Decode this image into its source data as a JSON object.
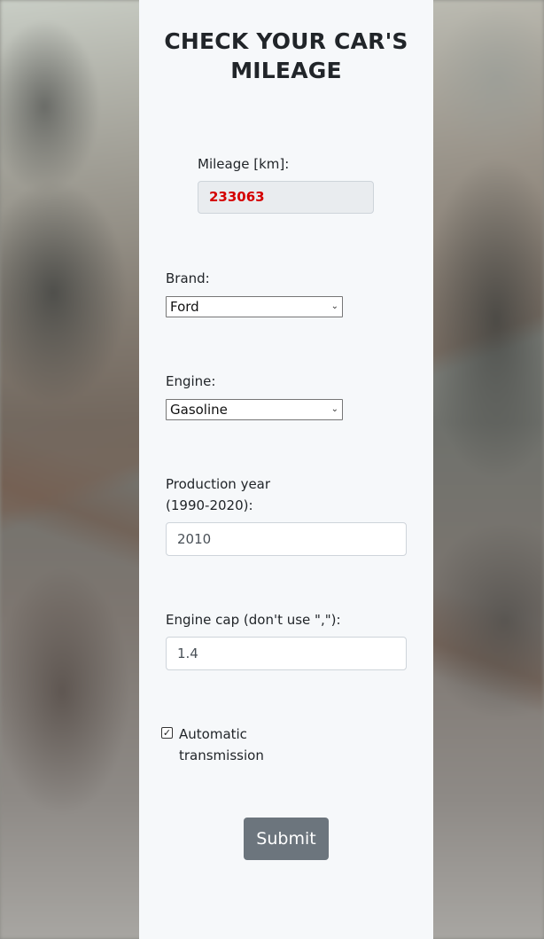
{
  "title": "CHECK YOUR CAR'S MILEAGE",
  "mileage": {
    "label": "Mileage [km]:",
    "value": "233063"
  },
  "brand": {
    "label": "Brand:",
    "selected": "Ford"
  },
  "engine": {
    "label": "Engine:",
    "selected": "Gasoline"
  },
  "production_year": {
    "label_line1": "Production year",
    "label_line2": "(1990-2020):",
    "value": "2010"
  },
  "engine_cap": {
    "label": "Engine cap (don't use \",\"):",
    "value": "1.4"
  },
  "automatic": {
    "label_line1": "Automatic",
    "label_line2": "transmission",
    "checked": true
  },
  "submit_label": "Submit",
  "colors": {
    "panel": "#f6f8fa",
    "mileage_value": "#d40000",
    "button": "#6c757d"
  }
}
